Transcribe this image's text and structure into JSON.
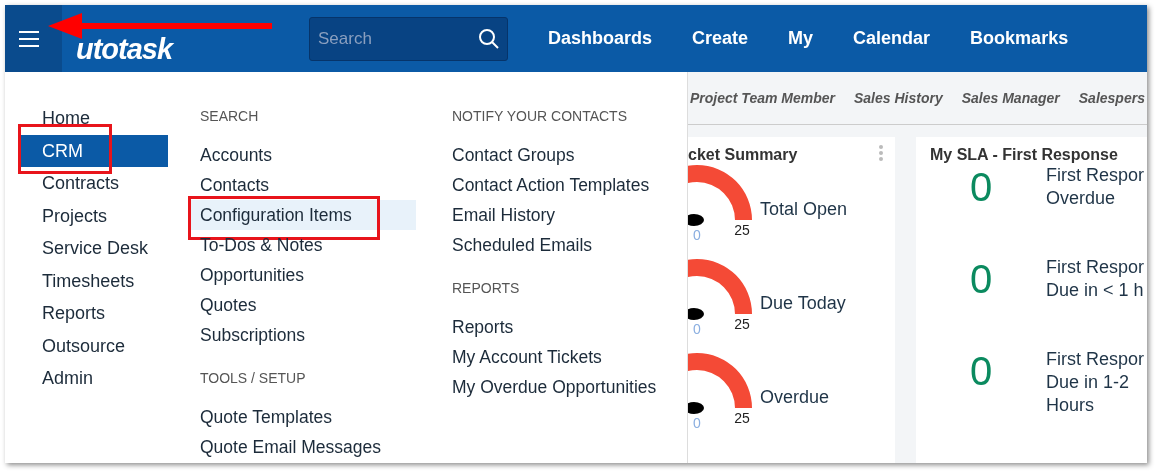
{
  "header": {
    "menu_button": {
      "callout": true
    },
    "logo": "utotask",
    "search": {
      "placeholder": "Search"
    },
    "nav": [
      "Dashboards",
      "Create",
      "My",
      "Calendar",
      "Bookmarks"
    ]
  },
  "menu": {
    "modules": [
      {
        "label": "Home",
        "selected": false,
        "callout": false
      },
      {
        "label": "CRM",
        "selected": true,
        "callout": true
      },
      {
        "label": "Contracts",
        "selected": false,
        "callout": false
      },
      {
        "label": "Projects",
        "selected": false,
        "callout": false
      },
      {
        "label": "Service Desk",
        "selected": false,
        "callout": false
      },
      {
        "label": "Timesheets",
        "selected": false,
        "callout": false
      },
      {
        "label": "Reports",
        "selected": false,
        "callout": false
      },
      {
        "label": "Outsource",
        "selected": false,
        "callout": false
      },
      {
        "label": "Admin",
        "selected": false,
        "callout": false
      }
    ],
    "columns": [
      [
        {
          "heading": "SEARCH",
          "items": [
            {
              "label": "Accounts",
              "hovered": false,
              "callout": false
            },
            {
              "label": "Contacts",
              "hovered": false,
              "callout": false
            },
            {
              "label": "Configuration Items",
              "hovered": true,
              "callout": true
            },
            {
              "label": "To-Dos & Notes",
              "hovered": false,
              "callout": false
            },
            {
              "label": "Opportunities",
              "hovered": false,
              "callout": false
            },
            {
              "label": "Quotes",
              "hovered": false,
              "callout": false
            },
            {
              "label": "Subscriptions",
              "hovered": false,
              "callout": false
            }
          ]
        },
        {
          "heading": "TOOLS / SETUP",
          "items": [
            {
              "label": "Quote Templates",
              "hovered": false,
              "callout": false
            },
            {
              "label": "Quote Email Messages",
              "hovered": false,
              "callout": false
            }
          ]
        }
      ],
      [
        {
          "heading": "NOTIFY YOUR CONTACTS",
          "items": [
            {
              "label": "Contact Groups",
              "hovered": false,
              "callout": false
            },
            {
              "label": "Contact Action Templates",
              "hovered": false,
              "callout": false
            },
            {
              "label": "Email History",
              "hovered": false,
              "callout": false
            },
            {
              "label": "Scheduled Emails",
              "hovered": false,
              "callout": false
            }
          ]
        },
        {
          "heading": "REPORTS",
          "items": [
            {
              "label": "Reports",
              "hovered": false,
              "callout": false
            },
            {
              "label": "My Account Tickets",
              "hovered": false,
              "callout": false
            },
            {
              "label": "My Overdue Opportunities",
              "hovered": false,
              "callout": false
            }
          ]
        }
      ]
    ]
  },
  "filters": [
    "Project Team Member",
    "Sales History",
    "Sales Manager",
    "Salespers"
  ],
  "widgets": [
    {
      "kind": "gauges",
      "title": "cket Summary",
      "rows": [
        {
          "label": "Total Open",
          "min": "0",
          "max": "25"
        },
        {
          "label": "Due Today",
          "min": "0",
          "max": "25"
        },
        {
          "label": "Overdue",
          "min": "0",
          "max": "25"
        }
      ]
    },
    {
      "kind": "counts",
      "title": "My SLA - First Response",
      "rows": [
        {
          "value": "0",
          "lines": [
            "First Respor",
            "Overdue"
          ]
        },
        {
          "value": "0",
          "lines": [
            "First Respor",
            "Due in < 1 h"
          ]
        },
        {
          "value": "0",
          "lines": [
            "First Respor",
            "Due in 1-2",
            "Hours"
          ]
        }
      ]
    }
  ]
}
